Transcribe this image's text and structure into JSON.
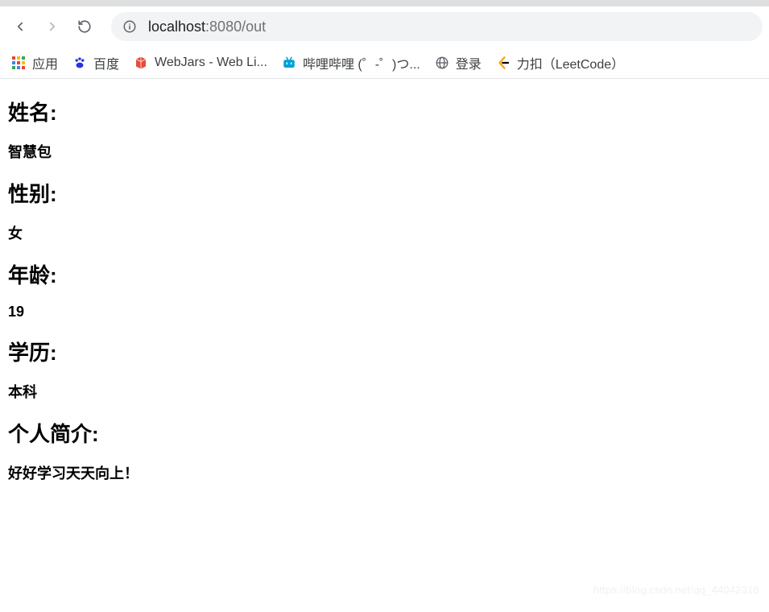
{
  "toolbar": {
    "url_host": "localhost",
    "url_rest": ":8080/out"
  },
  "bookmarks": {
    "apps": "应用",
    "baidu": "百度",
    "webjars": "WebJars - Web Li...",
    "bilibili": "哔哩哔哩 (゜-゜)つ...",
    "login": "登录",
    "leetcode": "力扣（LeetCode）"
  },
  "page": {
    "name_label": "姓名:",
    "name_value": "智慧包",
    "gender_label": "性别:",
    "gender_value": "女",
    "age_label": "年龄:",
    "age_value": "19",
    "edu_label": "学历:",
    "edu_value": "本科",
    "bio_label": "个人简介:",
    "bio_value": "好好学习天天向上！"
  },
  "watermark": "https://blog.csdn.net/qq_44042316"
}
